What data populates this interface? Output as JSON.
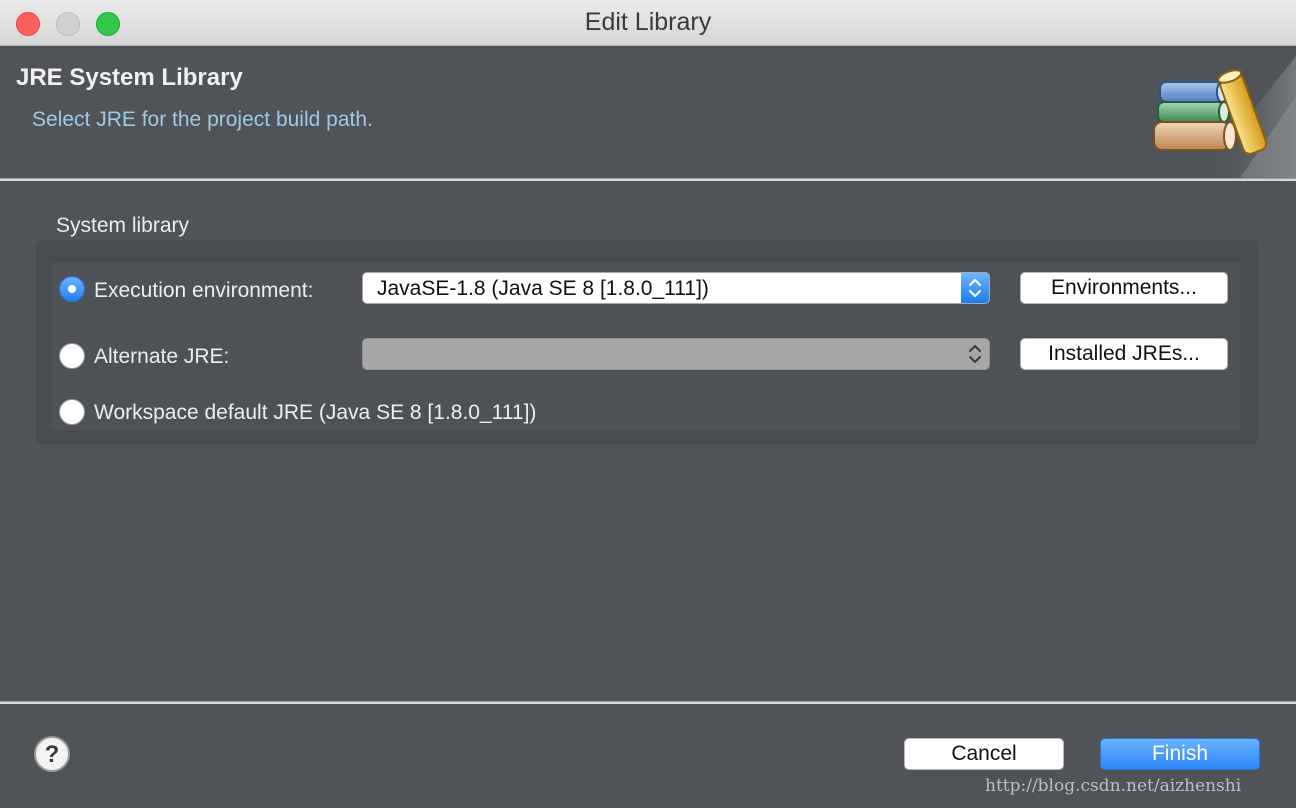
{
  "window": {
    "title": "Edit Library"
  },
  "header": {
    "title": "JRE System Library",
    "description": "Select JRE for the project build path.",
    "icon": "library-books-icon"
  },
  "system_library": {
    "label": "System library",
    "options": [
      {
        "label": "Execution environment:",
        "selected": true,
        "select_value": "JavaSE-1.8 (Java SE 8 [1.8.0_111])",
        "button_label": "Environments..."
      },
      {
        "label": "Alternate JRE:",
        "selected": false,
        "select_value": "",
        "button_label": "Installed JREs..."
      },
      {
        "label": "Workspace default JRE (Java SE 8 [1.8.0_111])",
        "selected": false
      }
    ]
  },
  "footer": {
    "help_icon": "help-icon",
    "cancel_label": "Cancel",
    "finish_label": "Finish"
  },
  "watermark": "http://blog.csdn.net/aizhenshi",
  "colors": {
    "accent": "#2a86f7",
    "banner_description": "#9ccbe6",
    "background": "#505357"
  }
}
